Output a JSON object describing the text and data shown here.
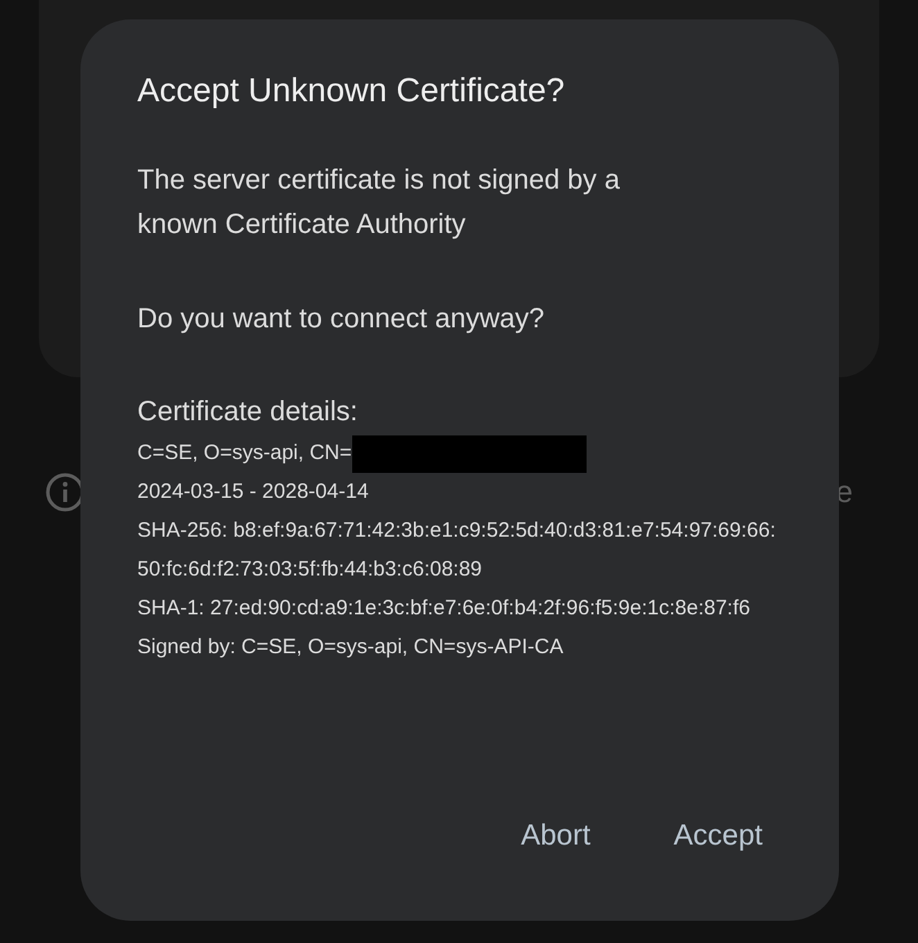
{
  "background": {
    "row_text": "e"
  },
  "dialog": {
    "title": "Accept Unknown Certificate?",
    "message": "The server certificate is not signed by a known Certificate Authority",
    "question": "Do you want to connect anyway?",
    "details_heading": "Certificate details:",
    "details": [
      {
        "text": "C=SE, O=sys-api, CN=",
        "redacted": true
      },
      {
        "text": "2024-03-15 - 2028-04-14",
        "redacted": false
      },
      {
        "text": "SHA-256: b8:ef:9a:67:71:42:3b:e1:c9:52:5d:40:d3:81:e7:54:97:69:66:50:fc:6d:f2:73:03:5f:fb:44:b3:c6:08:89",
        "redacted": false
      },
      {
        "text": "SHA-1: 27:ed:90:cd:a9:1e:3c:bf:e7:6e:0f:b4:2f:96:f5:9e:1c:8e:87:f6",
        "redacted": false
      },
      {
        "text": "Signed by: C=SE, O=sys-api, CN=sys-API-CA",
        "redacted": false
      }
    ],
    "buttons": [
      "Abort",
      "Accept"
    ]
  }
}
